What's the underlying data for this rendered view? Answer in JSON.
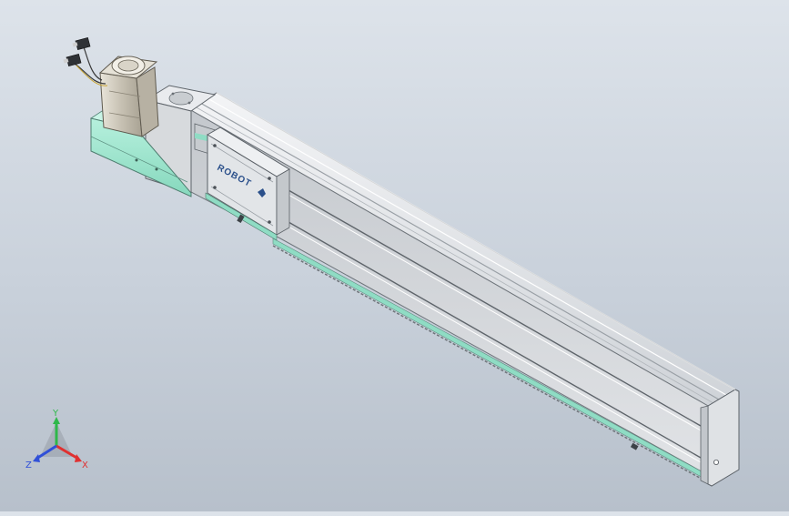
{
  "model": {
    "carriage_logo": "ROBOT",
    "colors": {
      "background_top": "#dde3ea",
      "background_bottom": "#b7c0cb",
      "rail_body": "#d5d8dc",
      "rail_dark": "#8e949a",
      "accent_mint": "#9fe6cf",
      "motor_metal": "#c9c4b8",
      "logo_blue": "#2a4f8a"
    }
  },
  "triad": {
    "x_label": "X",
    "y_label": "Y",
    "z_label": "Z",
    "x_color": "#e03030",
    "y_color": "#2eb84a",
    "z_color": "#3050d8"
  }
}
